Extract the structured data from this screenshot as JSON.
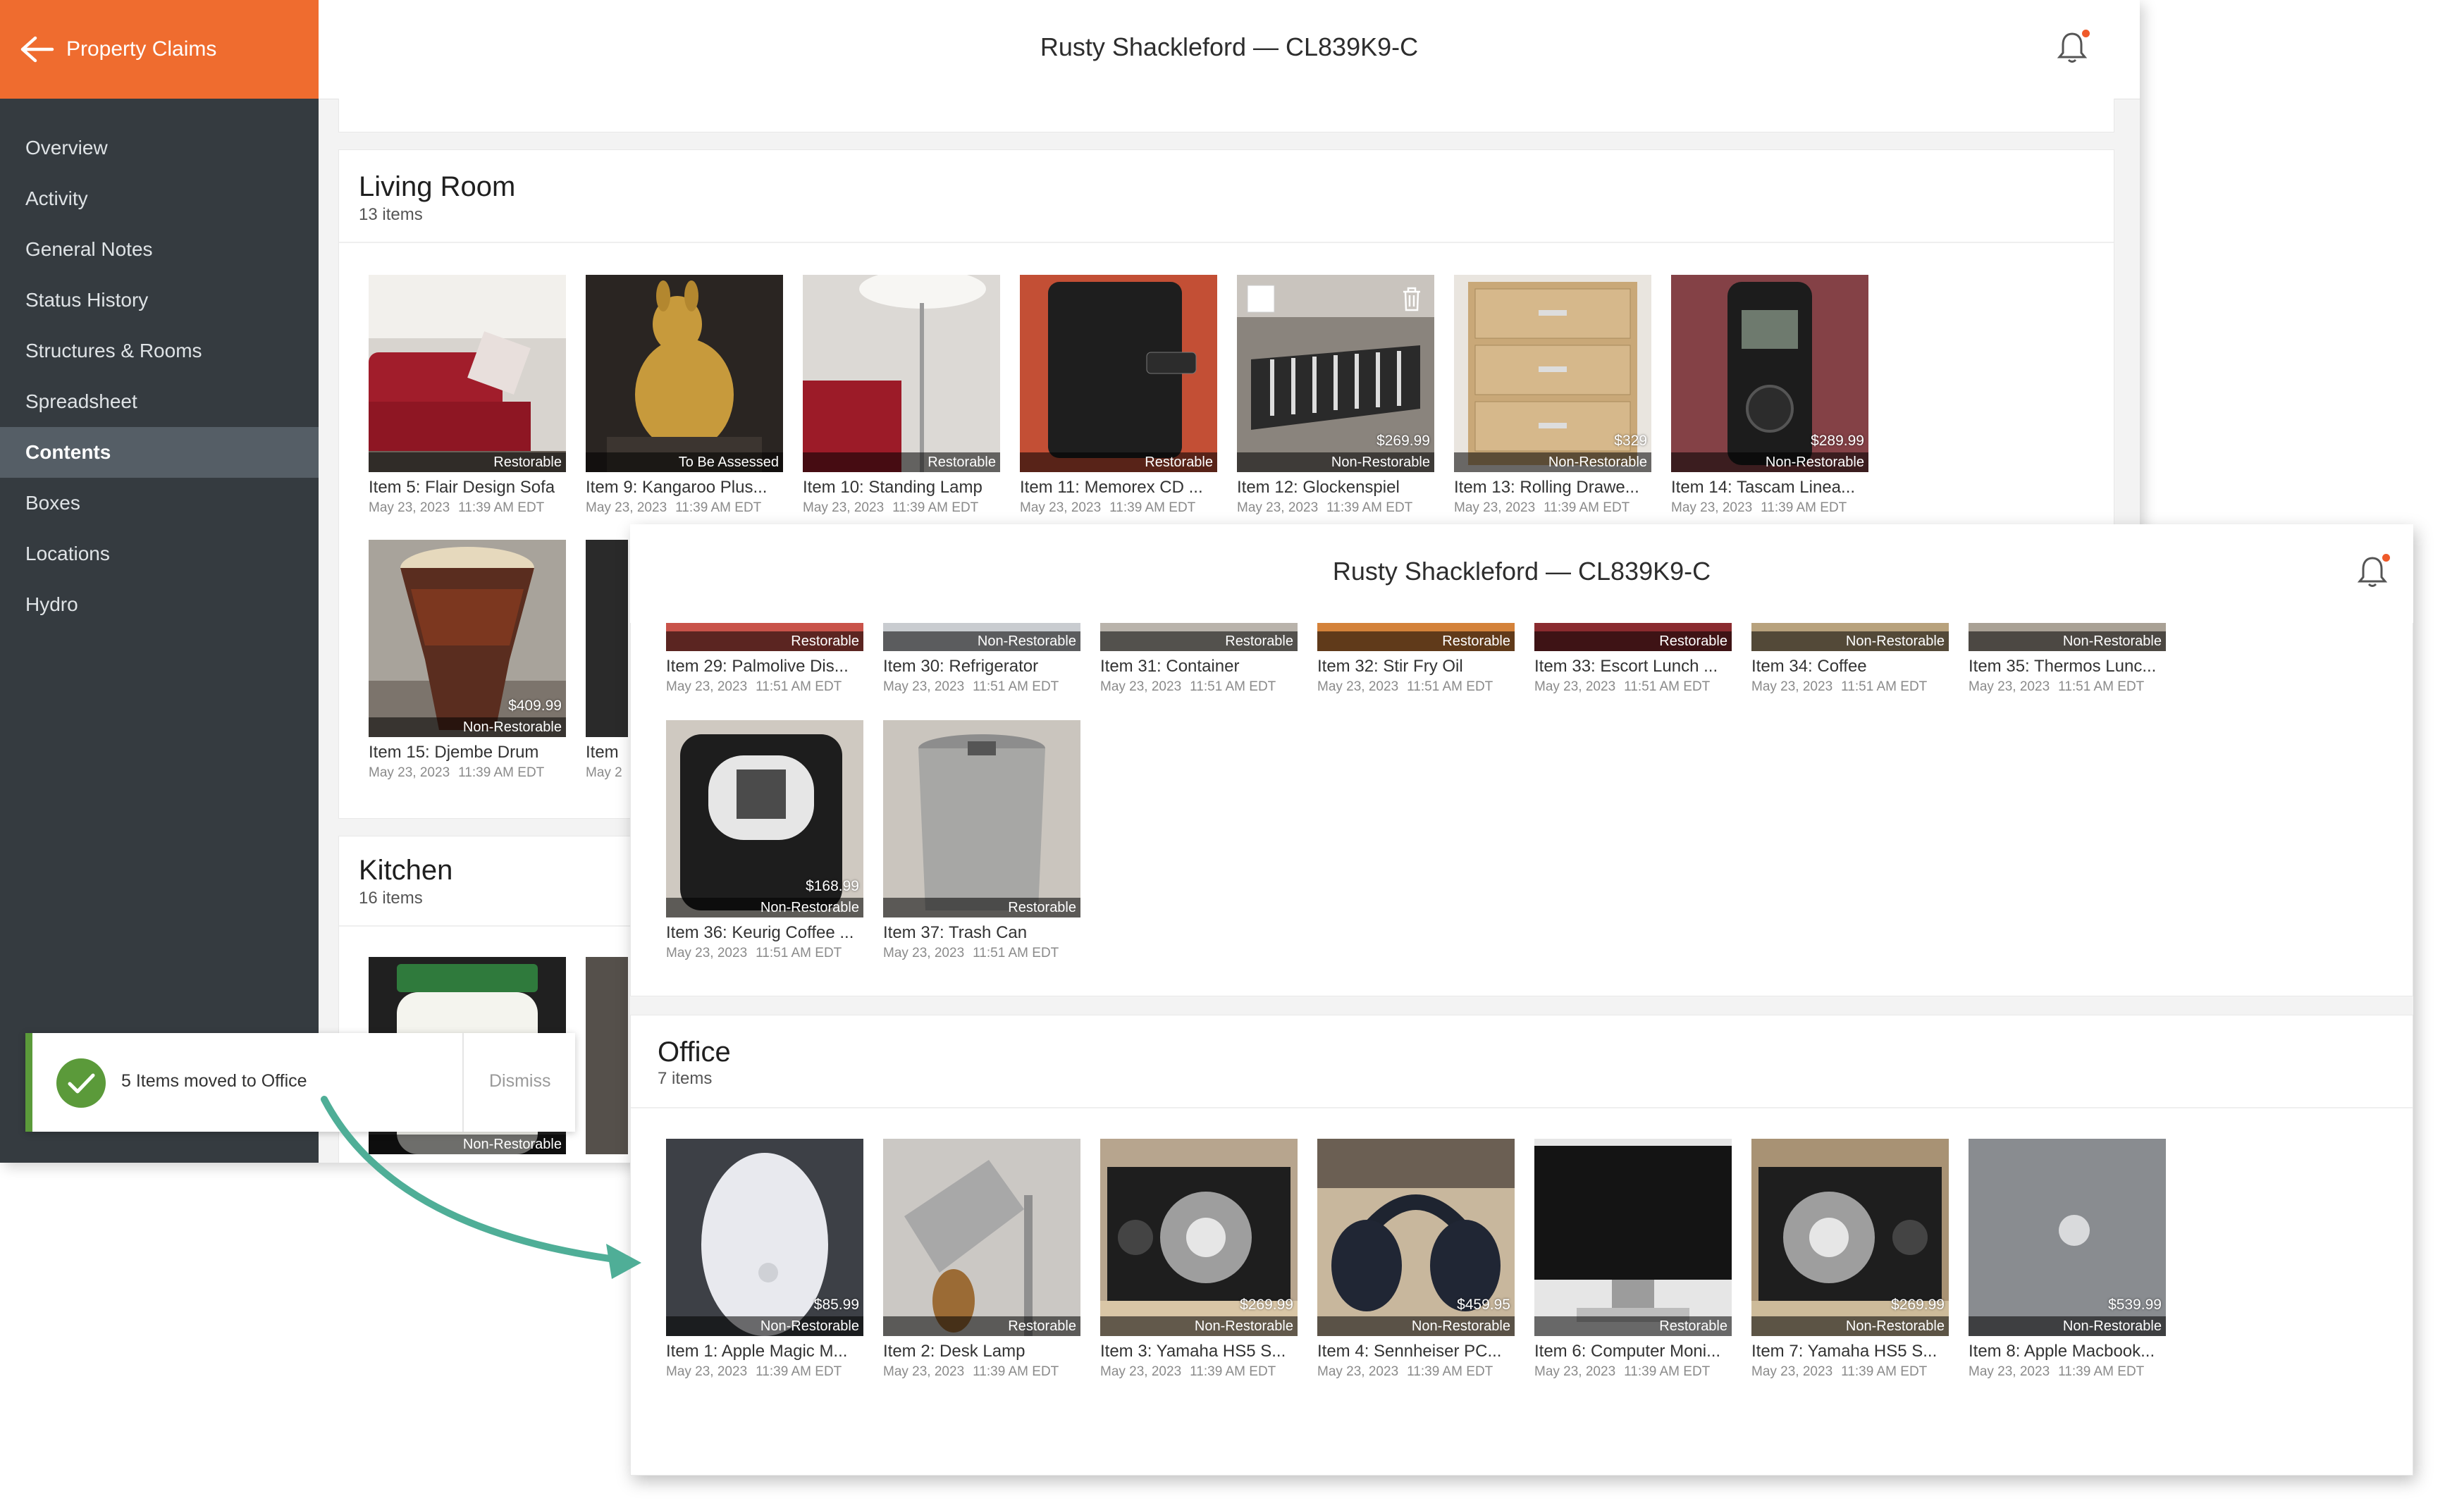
{
  "app": {
    "back_label": "Property Claims",
    "claim_title": "Rusty Shackleford — CL839K9-C"
  },
  "sidebar": {
    "items": [
      {
        "label": "Overview"
      },
      {
        "label": "Activity"
      },
      {
        "label": "General Notes"
      },
      {
        "label": "Status History"
      },
      {
        "label": "Structures & Rooms"
      },
      {
        "label": "Spreadsheet"
      },
      {
        "label": "Contents"
      },
      {
        "label": "Boxes"
      },
      {
        "label": "Locations"
      },
      {
        "label": "Hydro"
      }
    ],
    "active_index": 6
  },
  "living_room": {
    "title": "Living Room",
    "count": "13 items",
    "items": [
      {
        "name": "Item 5: Flair Design Sofa",
        "date": "May 23, 2023",
        "time": "11:39 AM EDT",
        "price": "",
        "status": "Restorable"
      },
      {
        "name": "Item 9: Kangaroo Plus...",
        "date": "May 23, 2023",
        "time": "11:39 AM EDT",
        "price": "",
        "status": "To Be Assessed"
      },
      {
        "name": "Item 10: Standing Lamp",
        "date": "May 23, 2023",
        "time": "11:39 AM EDT",
        "price": "",
        "status": "Restorable"
      },
      {
        "name": "Item 11: Memorex CD ...",
        "date": "May 23, 2023",
        "time": "11:39 AM EDT",
        "price": "",
        "status": "Restorable"
      },
      {
        "name": "Item 12: Glockenspiel",
        "date": "May 23, 2023",
        "time": "11:39 AM EDT",
        "price": "$269.99",
        "status": "Non-Restorable"
      },
      {
        "name": "Item 13: Rolling Drawe...",
        "date": "May 23, 2023",
        "time": "11:39 AM EDT",
        "price": "$329",
        "status": "Non-Restorable"
      },
      {
        "name": "Item 14: Tascam Linea...",
        "date": "May 23, 2023",
        "time": "11:39 AM EDT",
        "price": "$289.99",
        "status": "Non-Restorable"
      },
      {
        "name": "Item 15: Djembe Drum",
        "date": "May 23, 2023",
        "time": "11:39 AM EDT",
        "price": "$409.99",
        "status": "Non-Restorable"
      },
      {
        "name": "Item ",
        "date": "May 2",
        "time": "",
        "price": "",
        "status": ""
      }
    ]
  },
  "kitchen": {
    "title": "Kitchen",
    "count": "16 items",
    "partial_status": "Non-Restorable"
  },
  "toast": {
    "message": "5 Items moved to Office",
    "dismiss": "Dismiss"
  },
  "kitchen_front": {
    "row1": [
      {
        "name": "Item 29: Palmolive Dis...",
        "date": "May 23, 2023",
        "time": "11:51 AM EDT",
        "status": "Restorable"
      },
      {
        "name": "Item 30: Refrigerator",
        "date": "May 23, 2023",
        "time": "11:51 AM EDT",
        "status": "Non-Restorable"
      },
      {
        "name": "Item 31: Container",
        "date": "May 23, 2023",
        "time": "11:51 AM EDT",
        "status": "Restorable"
      },
      {
        "name": "Item 32: Stir Fry Oil",
        "date": "May 23, 2023",
        "time": "11:51 AM EDT",
        "status": "Restorable"
      },
      {
        "name": "Item 33: Escort Lunch ...",
        "date": "May 23, 2023",
        "time": "11:51 AM EDT",
        "status": "Restorable"
      },
      {
        "name": "Item 34: Coffee",
        "date": "May 23, 2023",
        "time": "11:51 AM EDT",
        "status": "Non-Restorable"
      },
      {
        "name": "Item 35: Thermos Lunc...",
        "date": "May 23, 2023",
        "time": "11:51 AM EDT",
        "status": "Non-Restorable"
      }
    ],
    "row2": [
      {
        "name": "Item 36: Keurig Coffee ...",
        "date": "May 23, 2023",
        "time": "11:51 AM EDT",
        "price": "$168.99",
        "status": "Non-Restorable"
      },
      {
        "name": "Item 37: Trash Can",
        "date": "May 23, 2023",
        "time": "11:51 AM EDT",
        "price": "",
        "status": "Restorable"
      }
    ]
  },
  "office": {
    "title": "Office",
    "count": "7 items",
    "items": [
      {
        "name": "Item 1: Apple Magic M...",
        "date": "May 23, 2023",
        "time": "11:39 AM EDT",
        "price": "$85.99",
        "status": "Non-Restorable"
      },
      {
        "name": "Item 2: Desk Lamp",
        "date": "May 23, 2023",
        "time": "11:39 AM EDT",
        "price": "",
        "status": "Restorable"
      },
      {
        "name": "Item 3: Yamaha HS5 S...",
        "date": "May 23, 2023",
        "time": "11:39 AM EDT",
        "price": "$269.99",
        "status": "Non-Restorable"
      },
      {
        "name": "Item 4: Sennheiser PC...",
        "date": "May 23, 2023",
        "time": "11:39 AM EDT",
        "price": "$459.95",
        "status": "Non-Restorable"
      },
      {
        "name": "Item 6: Computer Moni...",
        "date": "May 23, 2023",
        "time": "11:39 AM EDT",
        "price": "",
        "status": "Restorable"
      },
      {
        "name": "Item 7: Yamaha HS5 S...",
        "date": "May 23, 2023",
        "time": "11:39 AM EDT",
        "price": "$269.99",
        "status": "Non-Restorable"
      },
      {
        "name": "Item 8: Apple Macbook...",
        "date": "May 23, 2023",
        "time": "11:39 AM EDT",
        "price": "$539.99",
        "status": "Non-Restorable"
      }
    ]
  },
  "colors": {
    "brand_orange": "#ef6c2f",
    "sidebar_bg": "#353b40",
    "sidebar_active": "#555e66",
    "toast_green": "#5b9a3a",
    "arrow_teal": "#4fae97",
    "notification_dot": "#ef5a2a"
  },
  "icons": {
    "back": "arrow-left-icon",
    "notifications": "bell-icon",
    "success": "check-icon",
    "delete": "trash-icon",
    "select": "checkbox-icon"
  }
}
